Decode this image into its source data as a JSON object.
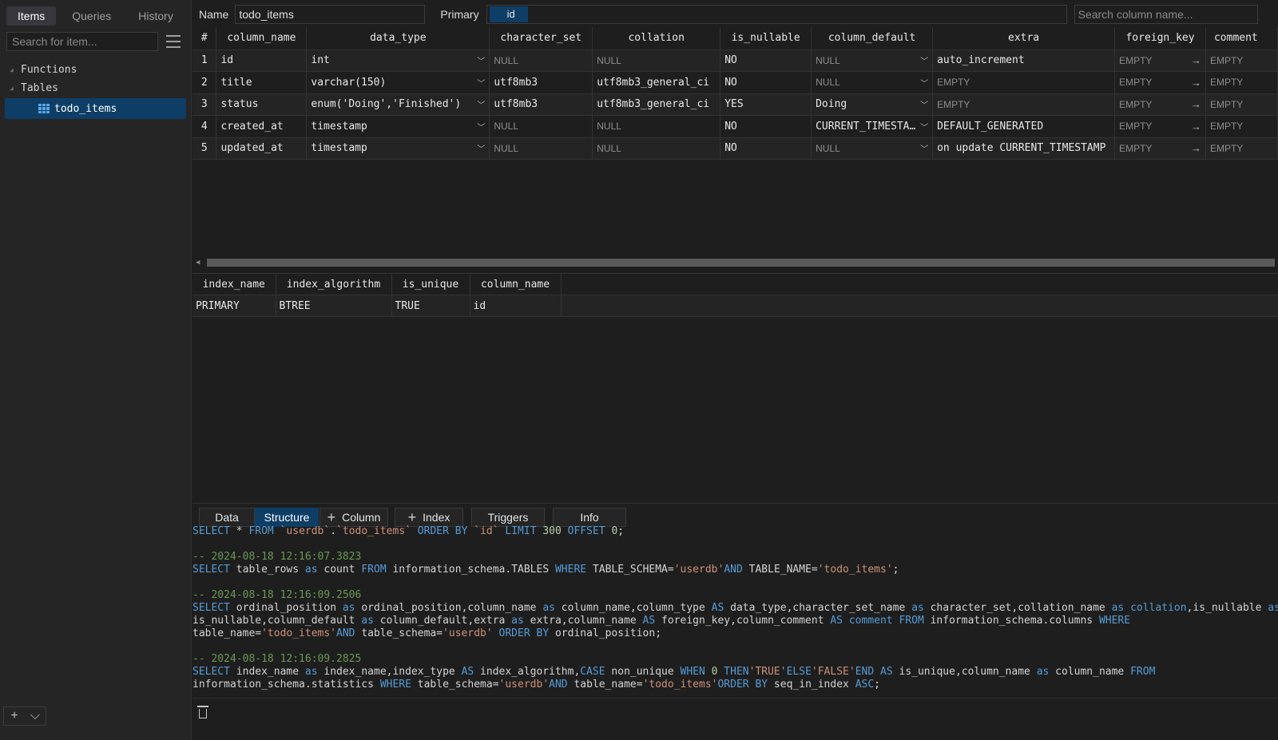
{
  "sidebar": {
    "tabs": [
      "Items",
      "Queries",
      "History"
    ],
    "search_placeholder": "Search for item...",
    "tree": {
      "functions_label": "Functions",
      "tables_label": "Tables",
      "table_item": "todo_items"
    },
    "bottom": {
      "add": "+",
      "menu": "⌵"
    }
  },
  "topbar": {
    "name_label": "Name",
    "name_value": "todo_items",
    "primary_label": "Primary",
    "primary_chip": "id",
    "column_search_placeholder": "Search column name..."
  },
  "columns_table": {
    "headers": [
      "#",
      "column_name",
      "data_type",
      "character_set",
      "collation",
      "is_nullable",
      "column_default",
      "extra",
      "foreign_key",
      "comment"
    ],
    "rows": [
      {
        "num": "1",
        "column_name": "id",
        "data_type": "int",
        "character_set": "NULL",
        "collation": "NULL",
        "is_nullable": "NO",
        "column_default": "NULL",
        "extra": "auto_increment",
        "foreign_key": "EMPTY",
        "comment": "EMPTY"
      },
      {
        "num": "2",
        "column_name": "title",
        "data_type": "varchar(150)",
        "character_set": "utf8mb3",
        "collation": "utf8mb3_general_ci",
        "is_nullable": "NO",
        "column_default": "NULL",
        "extra": "EMPTY",
        "foreign_key": "EMPTY",
        "comment": "EMPTY"
      },
      {
        "num": "3",
        "column_name": "status",
        "data_type": "enum('Doing','Finished')",
        "character_set": "utf8mb3",
        "collation": "utf8mb3_general_ci",
        "is_nullable": "YES",
        "column_default": "Doing",
        "extra": "EMPTY",
        "foreign_key": "EMPTY",
        "comment": "EMPTY"
      },
      {
        "num": "4",
        "column_name": "created_at",
        "data_type": "timestamp",
        "character_set": "NULL",
        "collation": "NULL",
        "is_nullable": "NO",
        "column_default": "CURRENT_TIMESTA…",
        "extra": "DEFAULT_GENERATED",
        "foreign_key": "EMPTY",
        "comment": "EMPTY"
      },
      {
        "num": "5",
        "column_name": "updated_at",
        "data_type": "timestamp",
        "character_set": "NULL",
        "collation": "NULL",
        "is_nullable": "NO",
        "column_default": "NULL",
        "extra": "on update CURRENT_TIMESTAMP",
        "foreign_key": "EMPTY",
        "comment": "EMPTY"
      }
    ]
  },
  "index_table": {
    "headers": [
      "index_name",
      "index_algorithm",
      "is_unique",
      "column_name"
    ],
    "rows": [
      {
        "index_name": "PRIMARY",
        "index_algorithm": "BTREE",
        "is_unique": "TRUE",
        "column_name": "id"
      }
    ]
  },
  "bottom_tabs": {
    "data": "Data",
    "structure": "Structure",
    "column": "Column",
    "index": "Index",
    "triggers": "Triggers",
    "info": "Info"
  },
  "query_log": [
    [
      [
        "kw",
        "SELECT"
      ],
      [
        "plain",
        " * "
      ],
      [
        "kw",
        "FROM"
      ],
      [
        "str",
        " `userdb`"
      ],
      [
        "plain",
        "."
      ],
      [
        "str",
        "`todo_items`"
      ],
      [
        "kw",
        " ORDER BY"
      ],
      [
        "str",
        " `id`"
      ],
      [
        "kw",
        " LIMIT"
      ],
      [
        "numc",
        " 300"
      ],
      [
        "kw",
        " OFFSET"
      ],
      [
        "numc",
        " 0"
      ],
      [
        "plain",
        ";"
      ]
    ],
    [],
    [
      [
        "cmt",
        "-- 2024-08-18 12:16:07.3823"
      ]
    ],
    [
      [
        "kw",
        "SELECT"
      ],
      [
        "plain",
        " table_rows "
      ],
      [
        "kw",
        "as"
      ],
      [
        "plain",
        " count "
      ],
      [
        "kw",
        "FROM"
      ],
      [
        "plain",
        " information_schema.TABLES "
      ],
      [
        "kw",
        "WHERE"
      ],
      [
        "plain",
        " TABLE_SCHEMA="
      ],
      [
        "str",
        "'userdb'"
      ],
      [
        "kw",
        "AND"
      ],
      [
        "plain",
        " TABLE_NAME="
      ],
      [
        "str",
        "'todo_items'"
      ],
      [
        "plain",
        ";"
      ]
    ],
    [],
    [
      [
        "cmt",
        "-- 2024-08-18 12:16:09.2506"
      ]
    ],
    [
      [
        "kw",
        "SELECT"
      ],
      [
        "plain",
        " ordinal_position "
      ],
      [
        "kw",
        "as"
      ],
      [
        "plain",
        " ordinal_position,column_name "
      ],
      [
        "kw",
        "as"
      ],
      [
        "plain",
        " column_name,column_type "
      ],
      [
        "kw",
        "AS"
      ],
      [
        "plain",
        " data_type,character_set_name "
      ],
      [
        "kw",
        "as"
      ],
      [
        "plain",
        " character_set,collation_name "
      ],
      [
        "kw",
        "as"
      ],
      [
        "kw",
        " collation"
      ],
      [
        "plain",
        ",is_nullable "
      ],
      [
        "kw",
        "as"
      ]
    ],
    [
      [
        "plain",
        "is_nullable,column_default "
      ],
      [
        "kw",
        "as"
      ],
      [
        "plain",
        " column_default,extra "
      ],
      [
        "kw",
        "as"
      ],
      [
        "plain",
        " extra,column_name "
      ],
      [
        "kw",
        "AS"
      ],
      [
        "plain",
        " foreign_key,column_comment "
      ],
      [
        "kw",
        "AS"
      ],
      [
        "kw",
        " comment"
      ],
      [
        "kw",
        " FROM"
      ],
      [
        "plain",
        " information_schema.columns "
      ],
      [
        "kw",
        "WHERE"
      ]
    ],
    [
      [
        "plain",
        "table_name="
      ],
      [
        "str",
        "'todo_items'"
      ],
      [
        "kw",
        "AND"
      ],
      [
        "plain",
        " table_schema="
      ],
      [
        "str",
        "'userdb'"
      ],
      [
        "kw",
        " ORDER BY"
      ],
      [
        "plain",
        " ordinal_position;"
      ]
    ],
    [],
    [
      [
        "cmt",
        "-- 2024-08-18 12:16:09.2825"
      ]
    ],
    [
      [
        "kw",
        "SELECT"
      ],
      [
        "plain",
        " index_name "
      ],
      [
        "kw",
        "as"
      ],
      [
        "plain",
        " index_name,index_type "
      ],
      [
        "kw",
        "AS"
      ],
      [
        "plain",
        " index_algorithm,"
      ],
      [
        "kw",
        "CASE"
      ],
      [
        "plain",
        " non_unique "
      ],
      [
        "kw",
        "WHEN"
      ],
      [
        "numc",
        " 0"
      ],
      [
        "kw",
        " THEN"
      ],
      [
        "str",
        "'TRUE'"
      ],
      [
        "kw",
        "ELSE"
      ],
      [
        "str",
        "'FALSE'"
      ],
      [
        "kw",
        "END AS"
      ],
      [
        "plain",
        " is_unique,column_name "
      ],
      [
        "kw",
        "as"
      ],
      [
        "plain",
        " column_name "
      ],
      [
        "kw",
        "FROM"
      ]
    ],
    [
      [
        "plain",
        "information_schema.statistics "
      ],
      [
        "kw",
        "WHERE"
      ],
      [
        "plain",
        " table_schema="
      ],
      [
        "str",
        "'userdb'"
      ],
      [
        "kw",
        "AND"
      ],
      [
        "plain",
        " table_name="
      ],
      [
        "str",
        "'todo_items'"
      ],
      [
        "kw",
        "ORDER BY"
      ],
      [
        "plain",
        " seq_in_index "
      ],
      [
        "kw",
        "ASC"
      ],
      [
        "plain",
        ";"
      ]
    ]
  ],
  "colors": {
    "accent": "#0e3e66",
    "background": "#1e1e1e",
    "sidebar": "#252526",
    "keyword": "#569cd6",
    "string": "#ce9178",
    "comment": "#6a9955"
  },
  "icons": {
    "filter": "filter-lines-icon",
    "table": "table-grid-icon",
    "trash": "trash-icon",
    "chevron": "chevron-down-icon",
    "arrow": "arrow-right-icon",
    "plus": "plus-icon"
  }
}
